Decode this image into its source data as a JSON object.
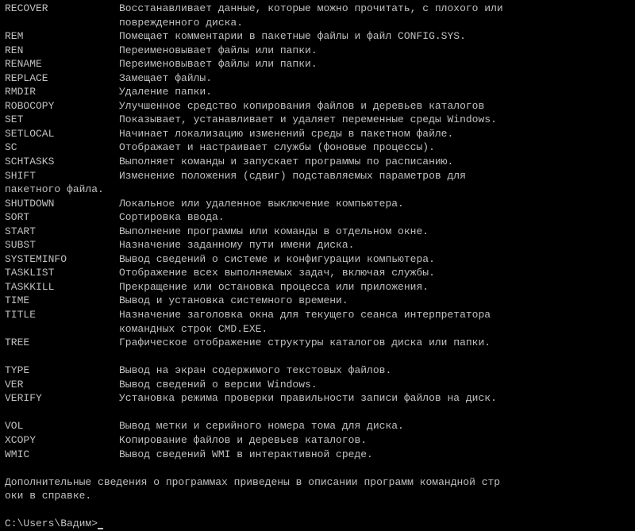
{
  "commands": [
    {
      "name": "RECOVER",
      "desc": "Восстанавливает данные, которые можно прочитать, с плохого или",
      "cont": "поврежденного диска."
    },
    {
      "name": "REM",
      "desc": "Помещает комментарии в пакетные файлы и файл CONFIG.SYS."
    },
    {
      "name": "REN",
      "desc": "Переименовывает файлы или папки."
    },
    {
      "name": "RENAME",
      "desc": "Переименовывает файлы или папки."
    },
    {
      "name": "REPLACE",
      "desc": "Замещает файлы."
    },
    {
      "name": "RMDIR",
      "desc": "Удаление папки."
    },
    {
      "name": "ROBOCOPY",
      "desc": "Улучшенное средство копирования файлов и деревьев каталогов"
    },
    {
      "name": "SET",
      "desc": "Показывает, устанавливает и удаляет переменные среды Windows."
    },
    {
      "name": "SETLOCAL",
      "desc": "Начинает локализацию изменений среды в пакетном файле."
    },
    {
      "name": "SC",
      "desc": "Отображает и настраивает службы (фоновые процессы)."
    },
    {
      "name": "SCHTASKS",
      "desc": "Выполняет команды и запускает программы по расписанию."
    },
    {
      "name": "SHIFT",
      "desc": "Изменение положения (сдвиг) подставляемых параметров для",
      "cont_full": "пакетного файла."
    },
    {
      "name": "SHUTDOWN",
      "desc": "Локальное или удаленное выключение компьютера."
    },
    {
      "name": "SORT",
      "desc": "Сортировка ввода."
    },
    {
      "name": "START",
      "desc": "Выполнение программы или команды в отдельном окне."
    },
    {
      "name": "SUBST",
      "desc": "Назначение заданному пути имени диска."
    },
    {
      "name": "SYSTEMINFO",
      "desc": "Вывод сведений о системе и конфигурации компьютера."
    },
    {
      "name": "TASKLIST",
      "desc": "Отображение всех выполняемых задач, включая службы."
    },
    {
      "name": "TASKKILL",
      "desc": "Прекращение или остановка процесса или приложения."
    },
    {
      "name": "TIME",
      "desc": "Вывод и установка системного времени."
    },
    {
      "name": "TITLE",
      "desc": "Назначение заголовка окна для текущего сеанса интерпретатора",
      "cont": "командных строк CMD.EXE."
    },
    {
      "name": "TREE",
      "desc": "Графическое отображение структуры каталогов диска или папки.",
      "blank_after": true
    },
    {
      "name": "TYPE",
      "desc": "Вывод на экран содержимого текстовых файлов."
    },
    {
      "name": "VER",
      "desc": "Вывод сведений о версии Windows."
    },
    {
      "name": "VERIFY",
      "desc": "Установка режима проверки правильности записи файлов на диск.",
      "blank_after": true
    },
    {
      "name": "VOL",
      "desc": "Вывод метки и серийного номера тома для диска."
    },
    {
      "name": "XCOPY",
      "desc": "Копирование файлов и деревьев каталогов."
    },
    {
      "name": "WMIC",
      "desc": "Вывод сведений WMI в интерактивной среде."
    }
  ],
  "footer_line1": "Дополнительные сведения о программах приведены в описании программ командной стр",
  "footer_line2": "оки в справке.",
  "prompt": "C:\\Users\\Вадим>"
}
